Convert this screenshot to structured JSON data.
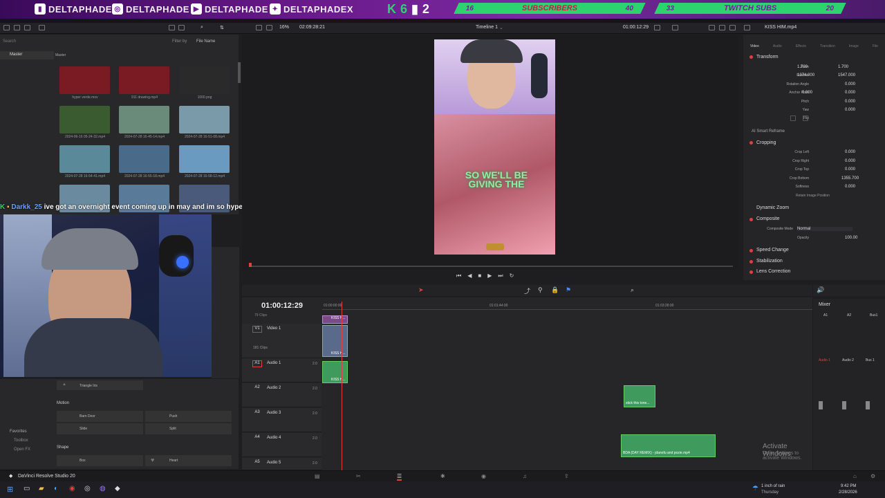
{
  "banner": {
    "socials": [
      {
        "icon": "twitch-icon",
        "name": "DELTAPHADE"
      },
      {
        "icon": "instagram-icon",
        "name": "DELTAPHADE"
      },
      {
        "icon": "youtube-icon",
        "name": "DELTAPHADE"
      },
      {
        "icon": "twitter-icon",
        "name": "DELTAPHADEX"
      }
    ],
    "k62": [
      "K",
      "6",
      "2"
    ],
    "subscribers": {
      "current": "16",
      "label": "SUBSCRIBERS",
      "goal": "40"
    },
    "twitch_subs": {
      "current": "33",
      "label": "TWITCH SUBS",
      "goal": "20"
    }
  },
  "toolbar": {
    "zoom": "16%",
    "source_timecode": "02:09:28:21",
    "timeline_name": "Timeline 1",
    "record_timecode": "01:00:12:29",
    "clip_name": "KISS HIM.mp4"
  },
  "media_pool": {
    "search_placeholder": "Search",
    "filter_label": "Filter by",
    "filter_value": "File Name",
    "bin": "Master",
    "header": "Master",
    "clips": [
      {
        "name": "hyper verde.mov",
        "color": "#7a1a22"
      },
      {
        "name": "911 drawing.mp4",
        "color": "#7a1a22"
      },
      {
        "name": "1000.png",
        "color": "#2a2a2a"
      },
      {
        "name": "2024-06-16 05-24-32.mp4",
        "color": "#3a5a30"
      },
      {
        "name": "2024-07-28 16-45-14.mp4",
        "color": "#6a8a7a"
      },
      {
        "name": "2024-07-28 16-51-08.mp4",
        "color": "#7a9aaa"
      },
      {
        "name": "2024-07-28 16-54-41.mp4",
        "color": "#5a8a9a"
      },
      {
        "name": "2024-07-28 16-55-18.mp4",
        "color": "#4a6a8a"
      },
      {
        "name": "2024-07-28 16-58-12.mp4",
        "color": "#6a9ac0"
      },
      {
        "name": "",
        "color": "#6a8aa0"
      },
      {
        "name": "",
        "color": "#5a7a9a"
      },
      {
        "name": "",
        "color": "#4a5a7a"
      }
    ]
  },
  "chat": {
    "user": "Darkk_25",
    "message": "ive got an overnight event coming up in may and im so hyped"
  },
  "effects": {
    "items_top": [
      "Triangle Iris"
    ],
    "motion_label": "Motion",
    "motion": [
      "Barn Door",
      "Push",
      "Slide",
      "Split"
    ],
    "shape_label": "Shape",
    "shape": [
      "Box",
      "Heart"
    ],
    "sidebar": [
      "Favorites",
      "Toolbox",
      "Open FX"
    ]
  },
  "viewer": {
    "overlay_text": "SO WE'LL BE GIVING THE"
  },
  "inspector": {
    "tabs": [
      "Video",
      "Audio",
      "Effects",
      "Transition",
      "Image",
      "File"
    ],
    "transform": "Transform",
    "zoom_label": "Zoom",
    "zoom_x": "1.700",
    "zoom_y": "1.700",
    "position_label": "Position",
    "position_x": "1374.000",
    "position_y": "1547.000",
    "rotation_label": "Rotation Angle",
    "rotation": "0.000",
    "anchor_label": "Anchor Point",
    "anchor_x": "0.000",
    "anchor_y": "0.000",
    "pitch_label": "Pitch",
    "pitch": "0.000",
    "yaw_label": "Yaw",
    "yaw": "0.000",
    "flip_label": "Flip",
    "smart_reframe": "AI Smart Reframe",
    "cropping": "Cropping",
    "crop_left_label": "Crop Left",
    "crop_left": "0.000",
    "crop_right_label": "Crop Right",
    "crop_right": "0.000",
    "crop_top_label": "Crop Top",
    "crop_top": "0.000",
    "crop_bottom_label": "Crop Bottom",
    "crop_bottom": "1355.700",
    "softness_label": "Softness",
    "softness": "0.000",
    "retain": "Retain Image Position",
    "dynamic_zoom": "Dynamic Zoom",
    "composite": "Composite",
    "composite_mode_label": "Composite Mode",
    "composite_mode": "Normal",
    "opacity_label": "Opacity",
    "opacity": "100.00",
    "speed_change": "Speed Change",
    "stabilization": "Stabilization",
    "lens_correction": "Lens Correction"
  },
  "timeline": {
    "timecode": "01:00:12:29",
    "ruler": [
      "01:00:00:00",
      "01:01:44:00",
      "01:03:28:00"
    ],
    "tracks": [
      {
        "id": "V1",
        "name": "Video 1",
        "info": "181 Clips"
      },
      {
        "id": "A1",
        "name": "Audio 1",
        "level": "2.0"
      },
      {
        "id": "A2",
        "name": "Audio 2",
        "level": "2.0"
      },
      {
        "id": "A3",
        "name": "Audio 3",
        "level": "2.0"
      },
      {
        "id": "A4",
        "name": "Audio 4",
        "level": "2.0"
      },
      {
        "id": "A5",
        "name": "Audio 5",
        "level": "2.0"
      }
    ],
    "top_info": "79 Clips",
    "clip_v1": "KISS H...",
    "clip_a2": "stick this tone...",
    "clip_a4": "BDA (DAY REMIX) - jdanofu and pozie.mp4"
  },
  "mixer": {
    "title": "Mixer",
    "channels": [
      "A1",
      "A2",
      "Bus1"
    ],
    "strips": [
      "Audio 1",
      "Audio 2",
      "Bus 1"
    ]
  },
  "watermark": {
    "line1": "Activate Windows",
    "line2": "Go to Settings to activate Windows."
  },
  "app": {
    "name": "DaVinci Resolve Studio 20"
  },
  "taskbar": {
    "weather": "1 inch of rain",
    "weather_sub": "Thursday",
    "time": "9:42 PM",
    "date": "2/28/2026"
  }
}
